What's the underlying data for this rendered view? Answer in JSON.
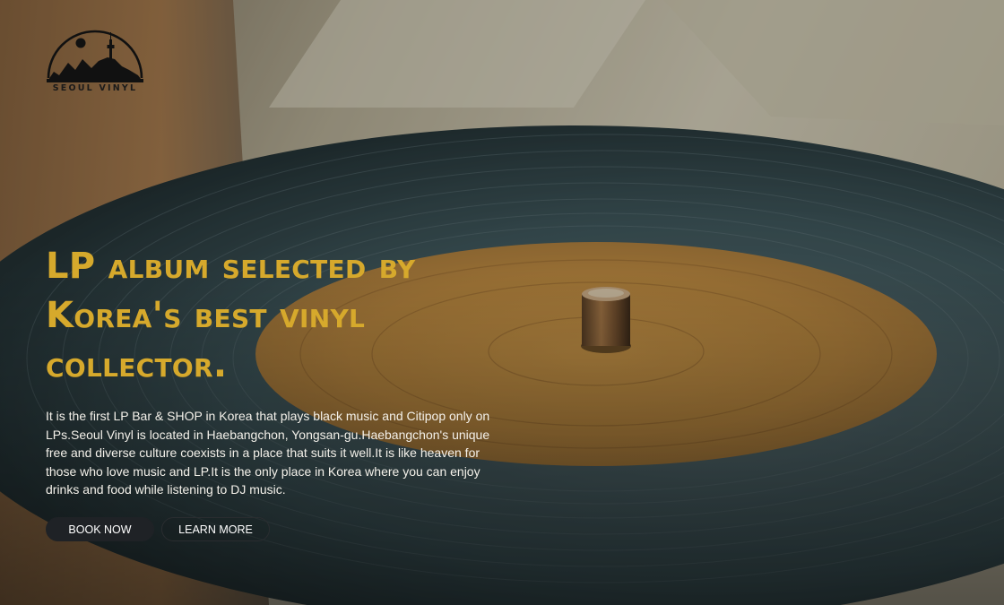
{
  "brand": {
    "logo_text": "SEOUL VINYL"
  },
  "hero": {
    "headline": "LP album selected by Korea's best vinyl collector.",
    "description": "It is the first LP Bar & SHOP in Korea that plays black music and Citipop only on LPs.Seoul Vinyl is located in Haebangchon, Yongsan-gu.Haebangchon's unique free and diverse culture coexists in a place that suits it well.It is like heaven for those who love music and LP.It is the only place in Korea where you can enjoy drinks and food while listening to DJ music."
  },
  "buttons": {
    "book_label": "BOOK NOW",
    "learn_label": "LEARN MORE"
  },
  "colors": {
    "headline": "#d6a92c",
    "body_text": "#f4f1ea",
    "primary_button": "#1f2226"
  },
  "icons": {
    "logo": "seoul-skyline-logo-icon"
  }
}
